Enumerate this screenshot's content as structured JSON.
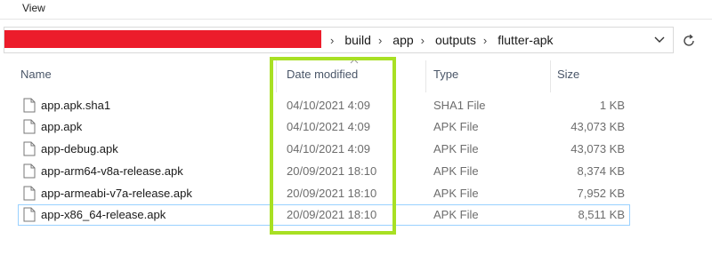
{
  "menu": {
    "view_label": "View"
  },
  "address_bar": {
    "crumbs": [
      "build",
      "app",
      "outputs",
      "flutter-apk"
    ]
  },
  "columns": {
    "name": "Name",
    "date": "Date modified",
    "type": "Type",
    "size": "Size"
  },
  "files": [
    {
      "name": "app.apk.sha1",
      "date": "04/10/2021 4:09",
      "type": "SHA1 File",
      "size": "1 KB"
    },
    {
      "name": "app.apk",
      "date": "04/10/2021 4:09",
      "type": "APK File",
      "size": "43,073 KB"
    },
    {
      "name": "app-debug.apk",
      "date": "04/10/2021 4:09",
      "type": "APK File",
      "size": "43,073 KB"
    },
    {
      "name": "app-arm64-v8a-release.apk",
      "date": "20/09/2021 18:10",
      "type": "APK File",
      "size": "8,374 KB"
    },
    {
      "name": "app-armeabi-v7a-release.apk",
      "date": "20/09/2021 18:10",
      "type": "APK File",
      "size": "7,952 KB"
    },
    {
      "name": "app-x86_64-release.apk",
      "date": "20/09/2021 18:10",
      "type": "APK File",
      "size": "8,511 KB"
    }
  ],
  "icons": {
    "breadcrumb_separator": "chevron-right-icon",
    "address_dropdown": "chevron-down-icon",
    "refresh": "refresh-icon",
    "file": "file-icon",
    "sort": "sort-up-icon"
  },
  "colors": {
    "redaction": "#ec1c2b",
    "highlight": "#a8e023",
    "selection_border": "#99d1ff"
  }
}
